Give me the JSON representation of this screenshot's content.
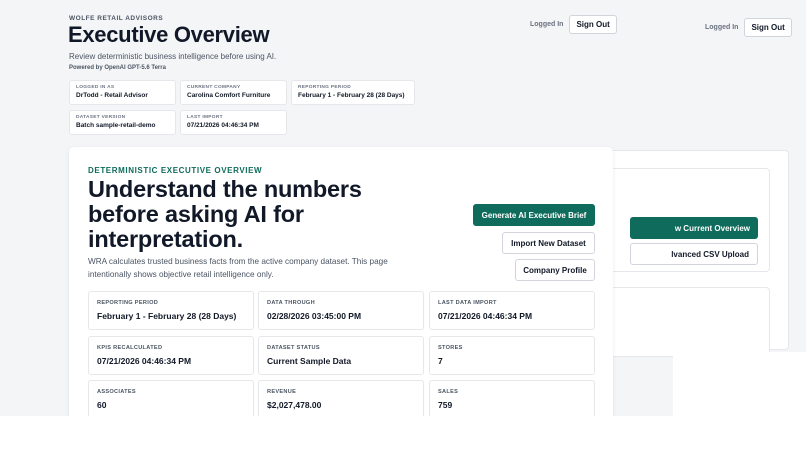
{
  "header": {
    "brand": "WOLFE RETAIL ADVISORS",
    "title": "Executive Overview",
    "subtitle": "Review deterministic business intelligence before using AI.",
    "powered_by": "Powered by OpenAI GPT-5.6 Terra"
  },
  "user_bar": {
    "logged_in_label": "Logged In",
    "sign_out_label": "Sign Out"
  },
  "meta": [
    {
      "label": "LOGGED IN AS",
      "value": "DrTodd - Retail Advisor"
    },
    {
      "label": "CURRENT COMPANY",
      "value": "Carolina Comfort Furniture"
    },
    {
      "label": "REPORTING PERIOD",
      "value": "February 1 - February 28 (28 Days)"
    },
    {
      "label": "DATASET VERSION",
      "value": "Batch sample-retail-demo"
    },
    {
      "label": "LAST IMPORT",
      "value": "07/21/2026 04:46:34 PM"
    }
  ],
  "background_panel": {
    "primary_button": "w Current Overview",
    "secondary_button": "lvanced CSV Upload"
  },
  "overview": {
    "eyebrow": "DETERMINISTIC EXECUTIVE OVERVIEW",
    "title": "Understand the numbers before asking AI for interpretation.",
    "description": "WRA calculates trusted business facts from the active company dataset. This page intentionally shows objective retail intelligence only."
  },
  "actions": {
    "generate": "Generate AI Executive Brief",
    "import": "Import New Dataset",
    "profile": "Company Profile"
  },
  "kpis": [
    {
      "label": "REPORTING PERIOD",
      "value": "February 1 - February 28 (28 Days)"
    },
    {
      "label": "DATA THROUGH",
      "value": "02/28/2026 03:45:00 PM"
    },
    {
      "label": "LAST DATA IMPORT",
      "value": "07/21/2026 04:46:34 PM"
    },
    {
      "label": "KPIS RECALCULATED",
      "value": "07/21/2026 04:46:34 PM"
    },
    {
      "label": "DATASET STATUS",
      "value": "Current Sample Data"
    },
    {
      "label": "STORES",
      "value": "7"
    },
    {
      "label": "ASSOCIATES",
      "value": "60"
    },
    {
      "label": "REVENUE",
      "value": "$2,027,478.00"
    },
    {
      "label": "SALES",
      "value": "759"
    }
  ],
  "colors": {
    "accent": "#0f6b5b",
    "page_bg": "#f4f5f7",
    "card_bg": "#ffffff"
  }
}
